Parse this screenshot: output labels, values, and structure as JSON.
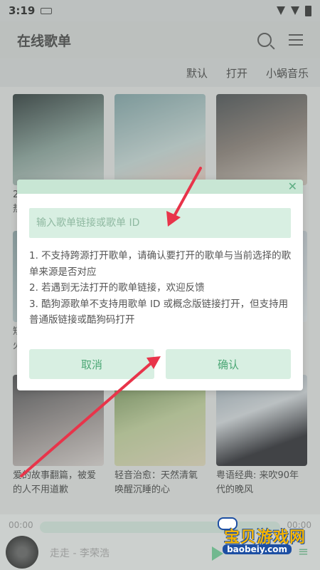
{
  "status_bar": {
    "time": "3:19"
  },
  "header": {
    "title": "在线歌单"
  },
  "sources": [
    "默认",
    "打开",
    "小蜗音乐"
  ],
  "grid": {
    "visible_captions": [
      "2",
      "热",
      "短",
      "火",
      "爱的故事翻篇，被爱的人不用道歉",
      "轻音治愈：天然清氧唤醒沉睡的心",
      "粤语经典: 来吹90年代的晚风"
    ]
  },
  "dialog": {
    "close_glyph": "✕",
    "input_placeholder": "输入歌单链接或歌单 ID",
    "notes": [
      "1. 不支持跨源打开歌单，请确认要打开的歌单与当前选择的歌单来源是否对应",
      "2. 若遇到无法打开的歌单链接，欢迎反馈",
      "3. 酷狗源歌单不支持用歌单 ID 或概念版链接打开，但支持用普通版链接或酷狗码打开"
    ],
    "cancel_label": "取消",
    "confirm_label": "确认"
  },
  "player": {
    "time_left": "00:00",
    "time_right": "00:00",
    "song": "走走 - 李荣浩"
  },
  "watermark": {
    "title": "宝贝游戏网",
    "url": "baobeiy.com"
  },
  "colors": {
    "accent": "#4da876",
    "accent_light": "#d8efe2",
    "arrow": "#e8344a"
  }
}
